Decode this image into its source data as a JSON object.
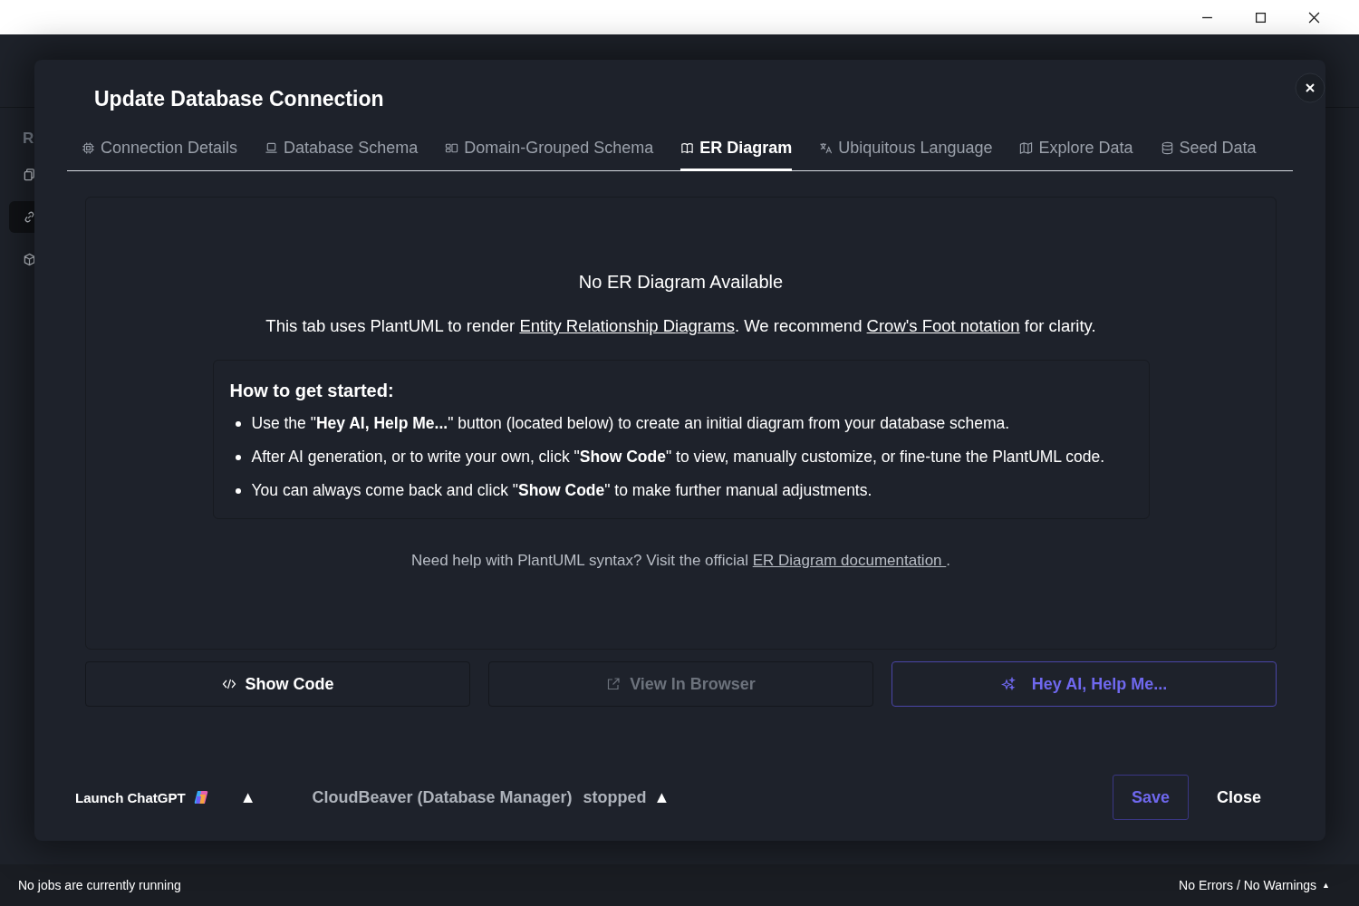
{
  "sidebar": {
    "heading": "R"
  },
  "dialog": {
    "title": "Update Database Connection",
    "tabs": [
      {
        "label": "Connection Details",
        "selected": false
      },
      {
        "label": "Database Schema",
        "selected": false
      },
      {
        "label": "Domain-Grouped Schema",
        "selected": false
      },
      {
        "label": "ER Diagram",
        "selected": true
      },
      {
        "label": "Ubiquitous Language",
        "selected": false
      },
      {
        "label": "Explore Data",
        "selected": false
      },
      {
        "label": "Seed Data",
        "selected": false
      }
    ],
    "empty_state": {
      "heading": "No ER Diagram Available",
      "intro": [
        {
          "kind": "text",
          "text": "This tab uses PlantUML to render "
        },
        {
          "kind": "link",
          "text": "Entity Relationship Diagrams"
        },
        {
          "kind": "text",
          "text": ". We recommend "
        },
        {
          "kind": "link",
          "text": "Crow's Foot notation"
        },
        {
          "kind": "text",
          "text": " for clarity."
        }
      ],
      "guide_title": "How to get started:",
      "steps": [
        "Use the \"**Hey AI, Help Me...**\" button (located below) to create an initial diagram from your database schema.",
        "After AI generation, or to write your own, click \"**Show Code**\" to view, manually customize, or fine-tune the PlantUML code.",
        "You can always come back and click \"**Show Code**\" to make further manual adjustments."
      ],
      "help": [
        {
          "kind": "text",
          "text": "Need help with PlantUML syntax? Visit the official "
        },
        {
          "kind": "link",
          "text": "ER Diagram documentation "
        },
        {
          "kind": "text",
          "text": "."
        }
      ]
    },
    "actions": [
      {
        "label": "Show Code",
        "kind": "code",
        "disabled": false
      },
      {
        "label": "View In Browser",
        "kind": "browser",
        "disabled": true
      },
      {
        "label": "Hey AI, Help Me...",
        "kind": "ai",
        "disabled": false
      }
    ],
    "footer": {
      "chatgpt": {
        "label": "Launch ChatGPT",
        "toggle": "▲"
      },
      "cloudbeaver": {
        "label": "CloudBeaver (Database Manager)",
        "status": "stopped",
        "toggle": "▲"
      },
      "buttons": [
        {
          "label": "Save",
          "kind": "primary"
        },
        {
          "label": "Close",
          "kind": "plain"
        }
      ]
    }
  },
  "status_bar": {
    "jobs": "No jobs are currently running",
    "problems": "No Errors / No Warnings",
    "toggle": "▲"
  }
}
